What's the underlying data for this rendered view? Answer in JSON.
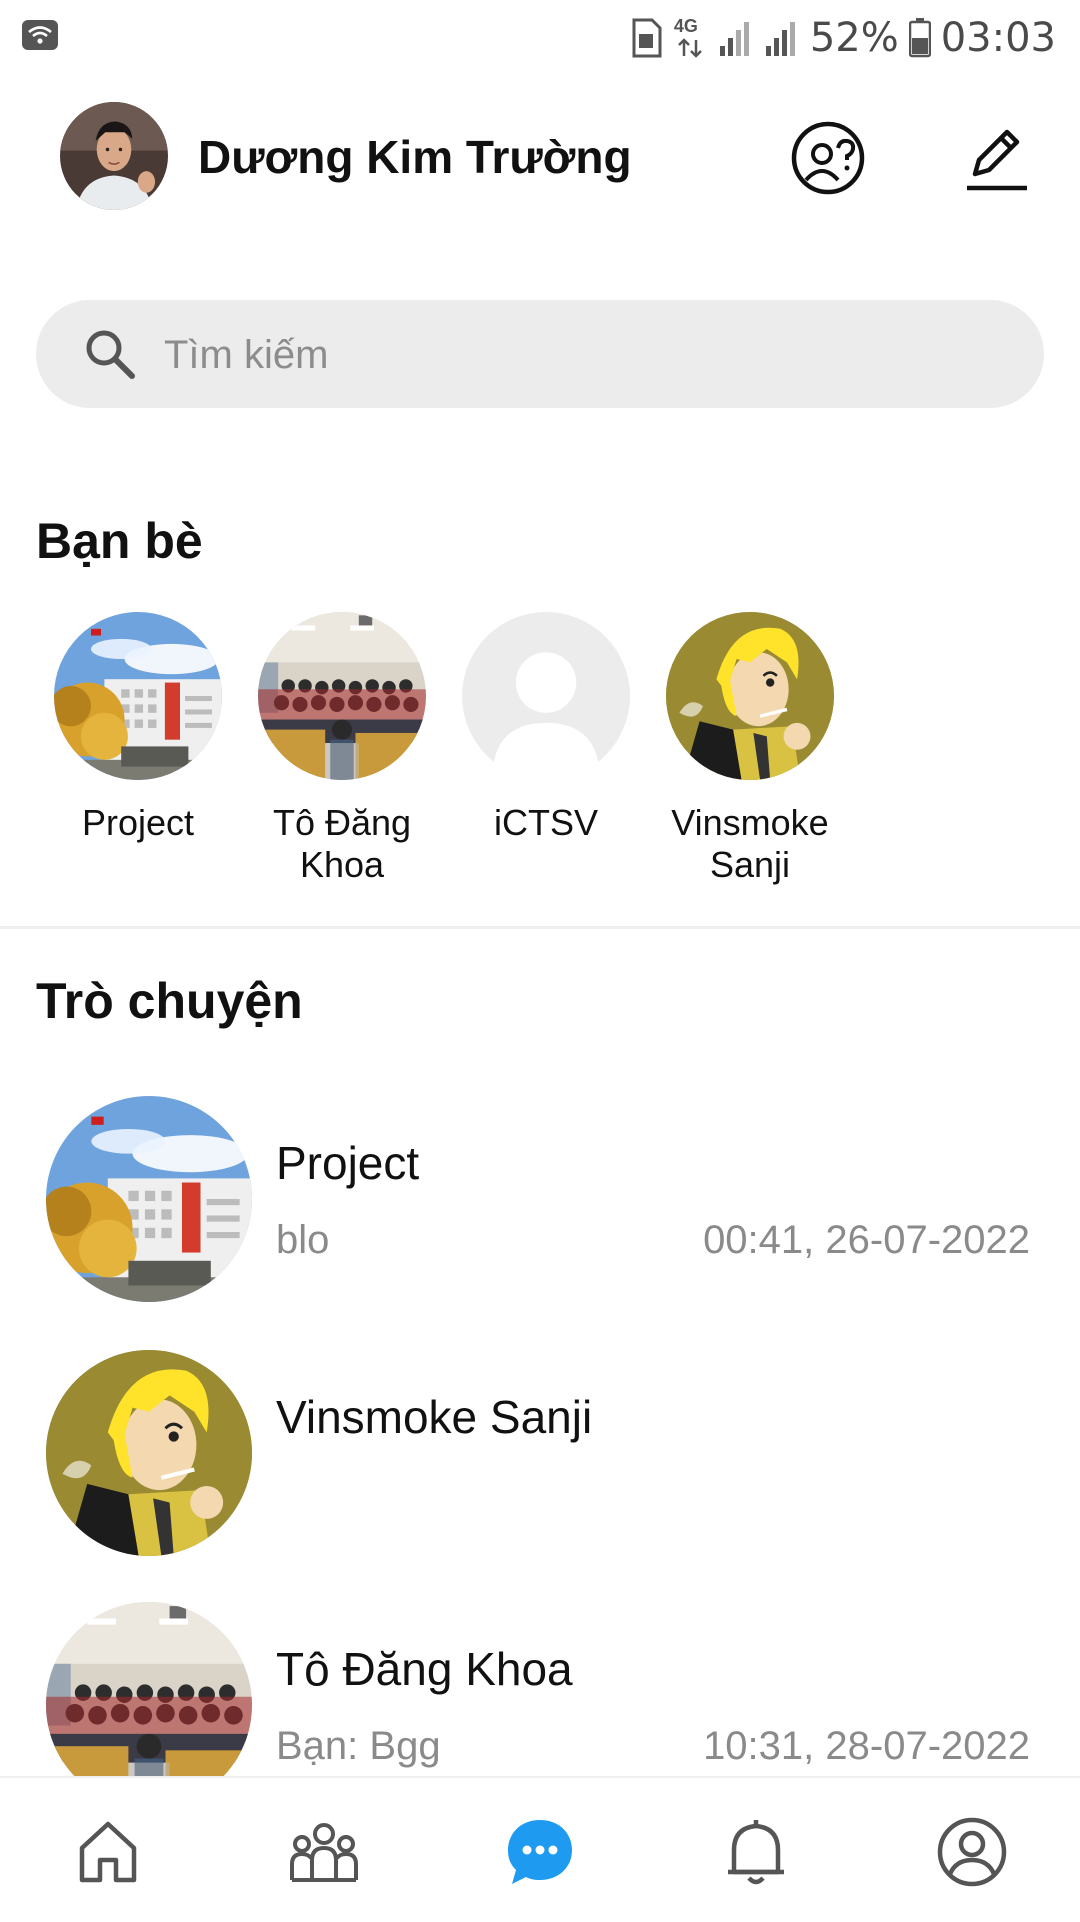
{
  "status_bar": {
    "network_type": "4G",
    "battery_percent": "52%",
    "time": "03:03",
    "icons": [
      "wifi-icon",
      "sim-icon",
      "data-arrows-icon",
      "signal-icon",
      "signal-icon",
      "battery-icon"
    ]
  },
  "header": {
    "user_name": "Dương Kim Trường",
    "buttons": [
      "help-chat-icon",
      "compose-icon"
    ]
  },
  "search": {
    "placeholder": "Tìm kiếm"
  },
  "friends": {
    "title": "Bạn bè",
    "items": [
      {
        "name": "Project",
        "avatar": "building-photo"
      },
      {
        "name": "Tô Đăng Khoa",
        "avatar": "classroom-photo"
      },
      {
        "name": "iCTSV",
        "avatar": "default-user-icon"
      },
      {
        "name": "Vinsmoke Sanji",
        "avatar": "anime-character-photo"
      }
    ]
  },
  "chats": {
    "title": "Trò chuyện",
    "items": [
      {
        "name": "Project",
        "last_message": "blo",
        "time": "00:41, 26-07-2022",
        "avatar": "building-photo"
      },
      {
        "name": "Vinsmoke Sanji",
        "last_message": "",
        "time": "",
        "avatar": "anime-character-photo"
      },
      {
        "name": "Tô Đăng Khoa",
        "last_message": "Bạn: Bgg",
        "time": "10:31, 28-07-2022",
        "avatar": "classroom-photo"
      }
    ]
  },
  "bottom_nav": {
    "items": [
      "home-icon",
      "friends-group-icon",
      "messages-icon",
      "notifications-bell-icon",
      "profile-icon"
    ],
    "active": "messages-icon"
  },
  "colors": {
    "accent": "#1e9bf0",
    "search_bg": "#ececec",
    "secondary_text": "#8a8a8a"
  }
}
